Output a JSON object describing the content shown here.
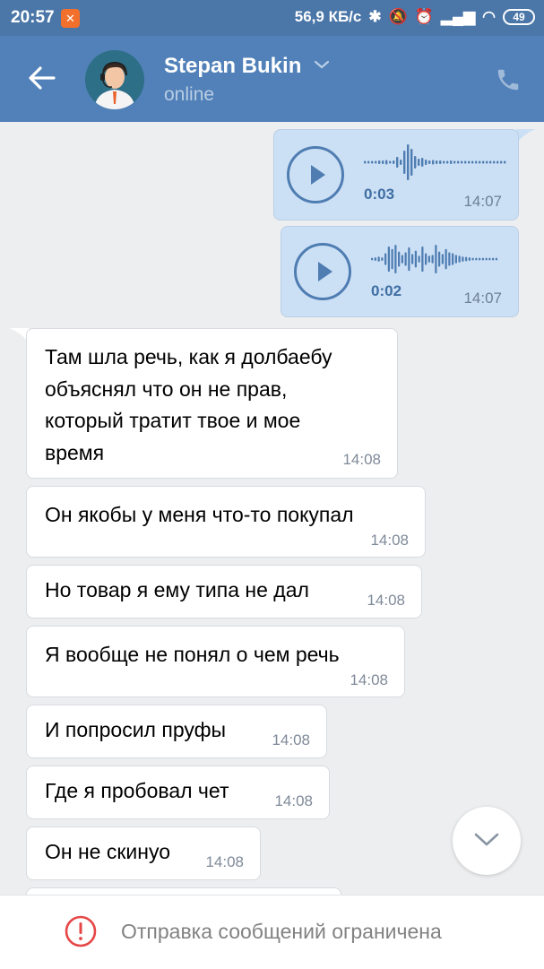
{
  "status_bar": {
    "time": "20:57",
    "notification_badge": "✕",
    "network_speed": "56,9 КБ/с",
    "battery": "49"
  },
  "header": {
    "contact_name": "Stepan Bukin",
    "contact_status": "online"
  },
  "voice_messages": [
    {
      "duration": "0:03",
      "time": "14:07"
    },
    {
      "duration": "0:02",
      "time": "14:07"
    }
  ],
  "messages": [
    {
      "lines": [
        "Там шла речь, как я долбаебу",
        "объяснял что он не прав,",
        "который тратит твое и мое",
        "время"
      ],
      "time": "14:08"
    },
    {
      "lines": [
        "Он якобы у меня что-то покупал"
      ],
      "time": "14:08"
    },
    {
      "lines": [
        "Но товар я ему типа не дал"
      ],
      "time": "14:08"
    },
    {
      "lines": [
        "Я вообще не понял о чем речь"
      ],
      "time": "14:08"
    },
    {
      "lines": [
        "И попросил пруфы"
      ],
      "time": "14:08"
    },
    {
      "lines": [
        "Где я пробовал чет"
      ],
      "time": "14:08"
    },
    {
      "lines": [
        "Он не скинуо"
      ],
      "time": "14:08"
    }
  ],
  "bottom_bar": {
    "restriction_text": "Отправка сообщений ограничена"
  },
  "colors": {
    "header": "#5181b8",
    "outgoing_bubble": "#cce0f5",
    "incoming_bubble": "#ffffff",
    "accent": "#4f7db2",
    "warning": "#e64646"
  }
}
